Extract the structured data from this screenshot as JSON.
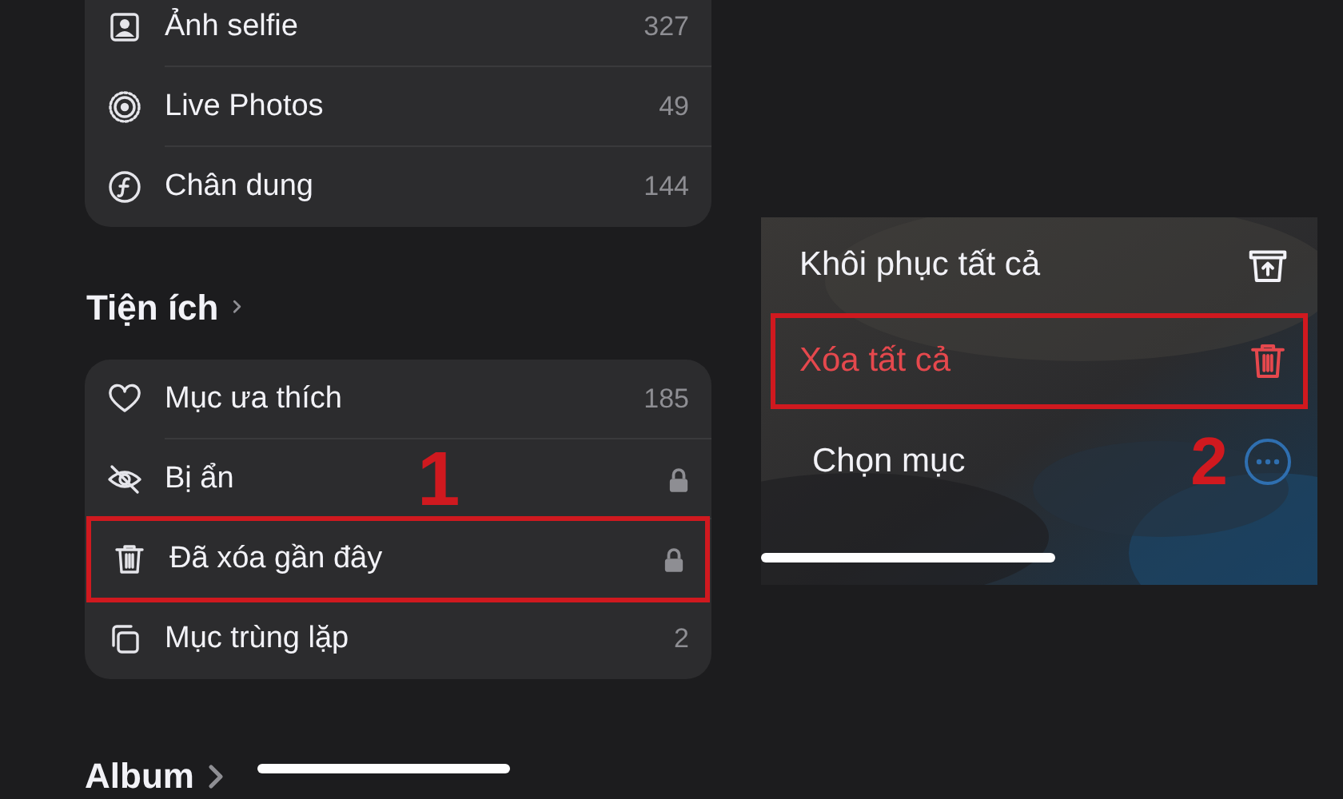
{
  "media_card": {
    "rows": [
      {
        "kind": "selfie",
        "label": "Ảnh selfie",
        "count": "327"
      },
      {
        "kind": "live",
        "label": "Live Photos",
        "count": "49"
      },
      {
        "kind": "portrait",
        "label": "Chân dung",
        "count": "144"
      }
    ]
  },
  "utilities": {
    "title": "Tiện ích",
    "rows": [
      {
        "kind": "heart",
        "label": "Mục ưa thích",
        "count": "185",
        "locked": false,
        "highlighted": false
      },
      {
        "kind": "hidden",
        "label": "Bị ẩn",
        "locked": true,
        "highlighted": false,
        "annotation": "1"
      },
      {
        "kind": "trash",
        "label": "Đã xóa gần đây",
        "locked": true,
        "highlighted": true
      },
      {
        "kind": "duplicate",
        "label": "Mục trùng lặp",
        "count": "2",
        "locked": false,
        "highlighted": false
      }
    ]
  },
  "album": {
    "title": "Album"
  },
  "action_menu": {
    "annotation": "2",
    "items": [
      {
        "kind": "restore",
        "label": "Khôi phục tất cả",
        "destructive": false
      },
      {
        "kind": "trash",
        "label": "Xóa tất cả",
        "destructive": true
      }
    ],
    "select": {
      "label": "Chọn mục"
    }
  }
}
